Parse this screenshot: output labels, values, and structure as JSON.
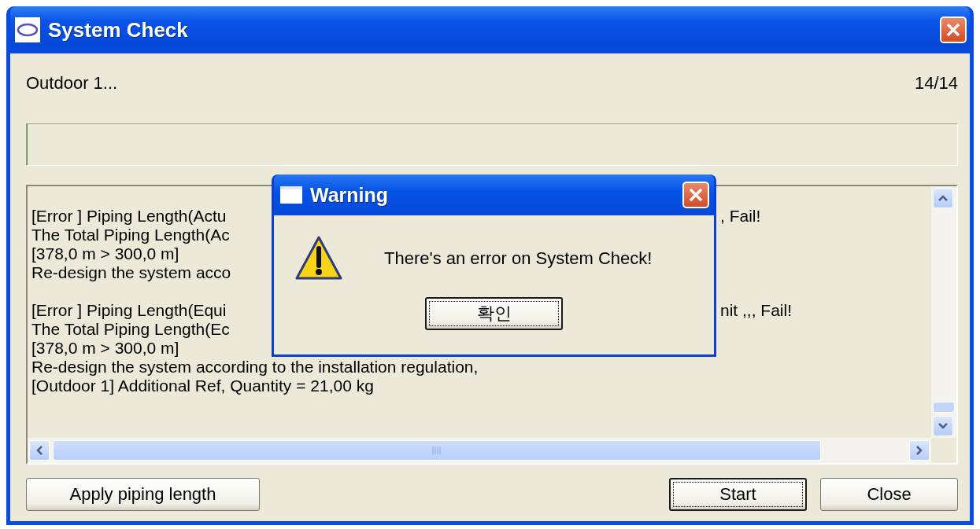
{
  "window": {
    "title": "System Check"
  },
  "status": {
    "label": "Outdoor  1...",
    "count": "14/14"
  },
  "progress": {
    "level": 0
  },
  "log": {
    "groups": [
      {
        "lines": [
          {
            "text": "[Error ] Piping Length(Actu",
            "tail": ", Fail!"
          },
          {
            "text": "The Total Piping Length(Ac"
          },
          {
            "text": "[378,0 m > 300,0 m]"
          },
          {
            "text": "Re-design the system acco"
          }
        ]
      },
      {
        "lines": [
          {
            "text": "[Error ] Piping Length(Equi",
            "tail": "nit ,,, Fail!"
          },
          {
            "text": "The Total Piping Length(Ec"
          },
          {
            "text": "[378,0 m > 300,0 m]"
          },
          {
            "text": "Re-design the system according to the installation regulation,"
          },
          {
            "text": "[Outdoor  1] Additional Ref, Quantity  = 21,00 kg"
          }
        ]
      }
    ]
  },
  "left_buttons": [
    {
      "label": "Apply piping length",
      "focused": false
    }
  ],
  "right_buttons": [
    {
      "label": "Start",
      "focused": true
    },
    {
      "label": "Close",
      "focused": false
    }
  ],
  "dialog": {
    "title": "Warning",
    "message": "There's an error on System Check!",
    "button": {
      "label": "확인",
      "focused": true
    }
  }
}
